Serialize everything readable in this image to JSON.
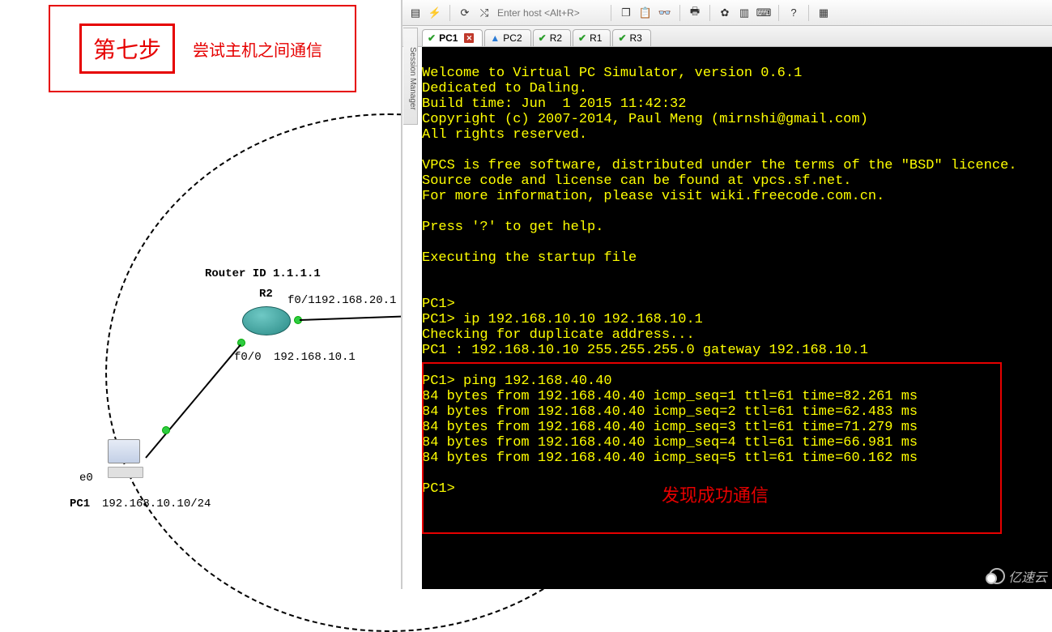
{
  "annotation": {
    "step_title": "第七步",
    "step_desc": "尝试主机之间通信",
    "success_note": "发现成功通信"
  },
  "topology": {
    "router_id_label": "Router ID 1.1.1.1",
    "r2_label": "R2",
    "f01_label": "f0/1",
    "f01_ip": "192.168.20.1",
    "f00_label": "f0/0",
    "f00_ip": "192.168.10.1",
    "pc1_label": "PC1",
    "pc1_iface": "e0",
    "pc1_ip": "192.168.10.10/24"
  },
  "app": {
    "session_manager": "Session Manager",
    "host_placeholder": "Enter host <Alt+R>",
    "tabs": [
      {
        "label": "PC1",
        "status": "tick",
        "closable": true,
        "active": true
      },
      {
        "label": "PC2",
        "status": "warn",
        "closable": false,
        "active": false
      },
      {
        "label": "R2",
        "status": "tick",
        "closable": false,
        "active": false
      },
      {
        "label": "R1",
        "status": "tick",
        "closable": false,
        "active": false
      },
      {
        "label": "R3",
        "status": "tick",
        "closable": false,
        "active": false
      }
    ]
  },
  "terminal": {
    "lines": [
      "",
      "Welcome to Virtual PC Simulator, version 0.6.1",
      "Dedicated to Daling.",
      "Build time: Jun  1 2015 11:42:32",
      "Copyright (c) 2007-2014, Paul Meng (mirnshi@gmail.com)",
      "All rights reserved.",
      "",
      "VPCS is free software, distributed under the terms of the \"BSD\" licence.",
      "Source code and license can be found at vpcs.sf.net.",
      "For more information, please visit wiki.freecode.com.cn.",
      "",
      "Press '?' to get help.",
      "",
      "Executing the startup file",
      "",
      "",
      "PC1>",
      "PC1> ip 192.168.10.10 192.168.10.1",
      "Checking for duplicate address...",
      "PC1 : 192.168.10.10 255.255.255.0 gateway 192.168.10.1",
      "",
      "PC1> ping 192.168.40.40",
      "84 bytes from 192.168.40.40 icmp_seq=1 ttl=61 time=82.261 ms",
      "84 bytes from 192.168.40.40 icmp_seq=2 ttl=61 time=62.483 ms",
      "84 bytes from 192.168.40.40 icmp_seq=3 ttl=61 time=71.279 ms",
      "84 bytes from 192.168.40.40 icmp_seq=4 ttl=61 time=66.981 ms",
      "84 bytes from 192.168.40.40 icmp_seq=5 ttl=61 time=60.162 ms",
      "",
      "PC1>"
    ]
  },
  "watermark": "亿速云"
}
